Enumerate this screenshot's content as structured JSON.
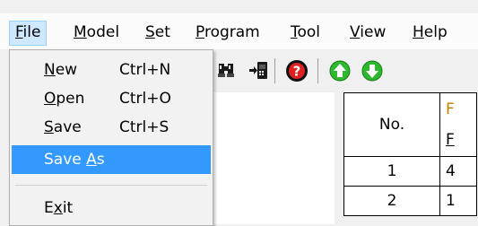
{
  "menubar": [
    {
      "pre": "",
      "key": "F",
      "post": "ile",
      "active": true
    },
    {
      "pre": "",
      "key": "M",
      "post": "odel",
      "active": false
    },
    {
      "pre": "",
      "key": "S",
      "post": "et",
      "active": false
    },
    {
      "pre": "",
      "key": "P",
      "post": "rogram",
      "active": false
    },
    {
      "pre": "",
      "key": "T",
      "post": "ool",
      "active": false
    },
    {
      "pre": "",
      "key": "V",
      "post": "iew",
      "active": false
    },
    {
      "pre": "",
      "key": "H",
      "post": "elp",
      "active": false
    }
  ],
  "file_menu": {
    "items": [
      {
        "pre": "",
        "key": "N",
        "post": "ew",
        "shortcut": "Ctrl+N"
      },
      {
        "pre": "",
        "key": "O",
        "post": "pen",
        "shortcut": "Ctrl+O"
      },
      {
        "pre": "",
        "key": "S",
        "post": "ave",
        "shortcut": "Ctrl+S"
      },
      {
        "pre": "Save ",
        "key": "A",
        "post": "s",
        "shortcut": ""
      },
      {
        "pre": "E",
        "key": "x",
        "post": "it",
        "shortcut": ""
      }
    ]
  },
  "toolbar": {
    "icons": [
      "binoculars-icon",
      "download-to-device-icon",
      "help-icon",
      "up-arrow-icon",
      "down-arrow-icon"
    ]
  },
  "table": {
    "header": "No.",
    "header_partial_top": "F",
    "header_partial_bottom": "F",
    "rows": [
      {
        "no": "1",
        "value": "4"
      },
      {
        "no": "2",
        "value": "1"
      }
    ]
  },
  "colors": {
    "menu_highlight": "#3399ff",
    "menubar_active": "#cde8ff",
    "arrow_green": "#2eb82e",
    "help_red": "#e02020"
  }
}
